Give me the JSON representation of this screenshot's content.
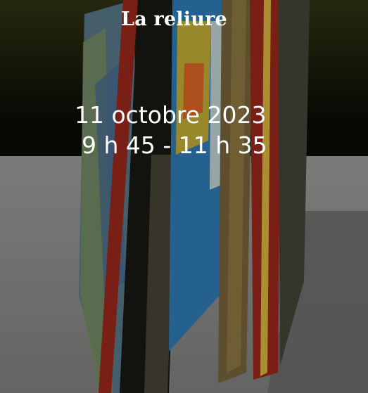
{
  "event": {
    "title": "La reliure",
    "date": "11 octobre 2023",
    "time": "9 h 45 - 11 h 35"
  },
  "background": {
    "subject": "open-book-photo",
    "wall_color": "#1c1d0b",
    "table_color": "#828281",
    "book_edge_color": "#8a2418"
  }
}
